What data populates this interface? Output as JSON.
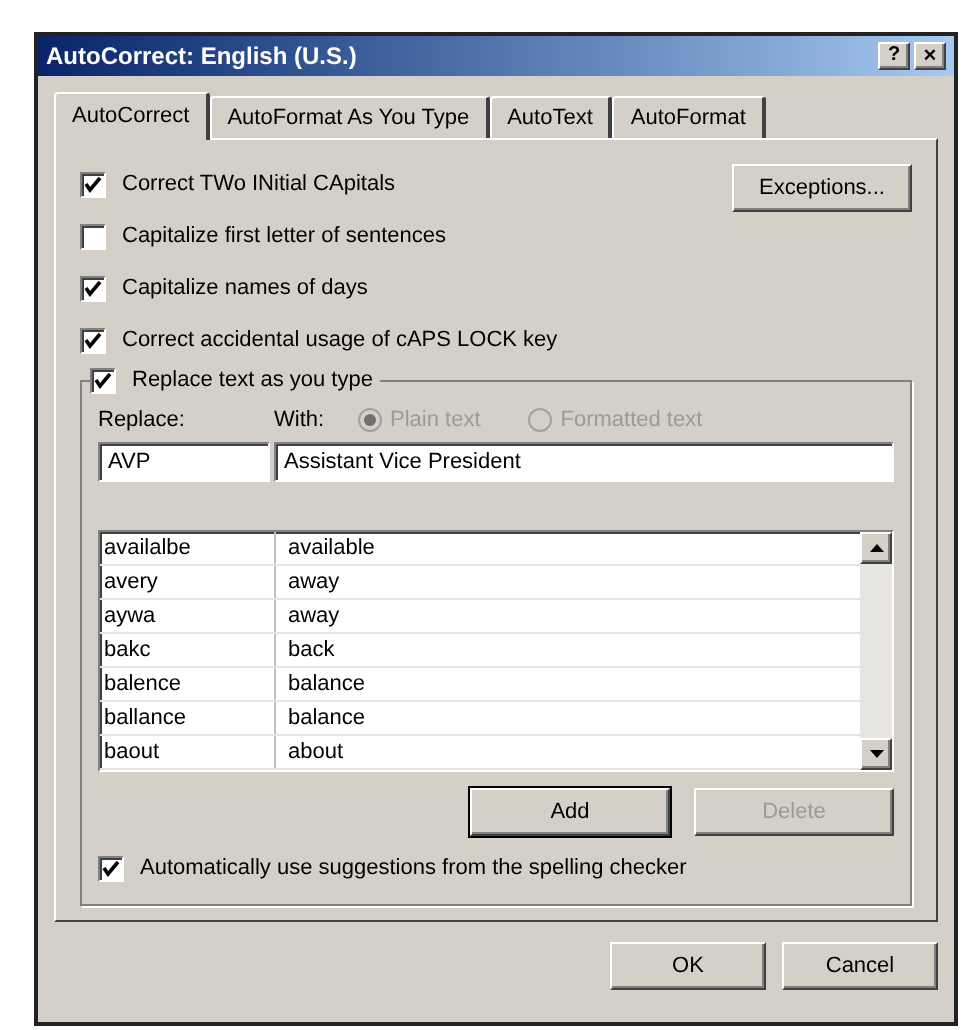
{
  "window": {
    "title": "AutoCorrect: English (U.S.)",
    "help_button": "?",
    "close_button": "×"
  },
  "tabs": [
    {
      "label": "AutoCorrect",
      "selected": true
    },
    {
      "label": "AutoFormat As You Type",
      "selected": false
    },
    {
      "label": "AutoText",
      "selected": false
    },
    {
      "label": "AutoFormat",
      "selected": false
    }
  ],
  "options": [
    {
      "label": "Correct TWo INitial CApitals",
      "checked": true
    },
    {
      "label": "Capitalize first letter of sentences",
      "checked": false
    },
    {
      "label": "Capitalize names of days",
      "checked": true
    },
    {
      "label": "Correct accidental usage of cAPS LOCK key",
      "checked": true
    }
  ],
  "exceptions_button": "Exceptions...",
  "replace_group": {
    "label": "Replace text as you type",
    "checked": true,
    "replace_label": "Replace:",
    "with_label": "With:",
    "formats": [
      {
        "label": "Plain text",
        "selected": true,
        "disabled": true
      },
      {
        "label": "Formatted text",
        "selected": false,
        "disabled": true
      }
    ],
    "replace_value": "AVP",
    "with_value": "Assistant Vice President",
    "rows": [
      [
        "availalbe",
        "available"
      ],
      [
        "avery",
        "away"
      ],
      [
        "aywa",
        "away"
      ],
      [
        "bakc",
        "back"
      ],
      [
        "balence",
        "balance"
      ],
      [
        "ballance",
        "balance"
      ],
      [
        "baout",
        "about"
      ]
    ],
    "buttons": [
      {
        "label": "Add",
        "disabled": false
      },
      {
        "label": "Delete",
        "disabled": true
      }
    ],
    "suggestions": {
      "label": "Automatically use suggestions from the spelling checker",
      "checked": true
    }
  },
  "footer_buttons": [
    "OK",
    "Cancel"
  ]
}
